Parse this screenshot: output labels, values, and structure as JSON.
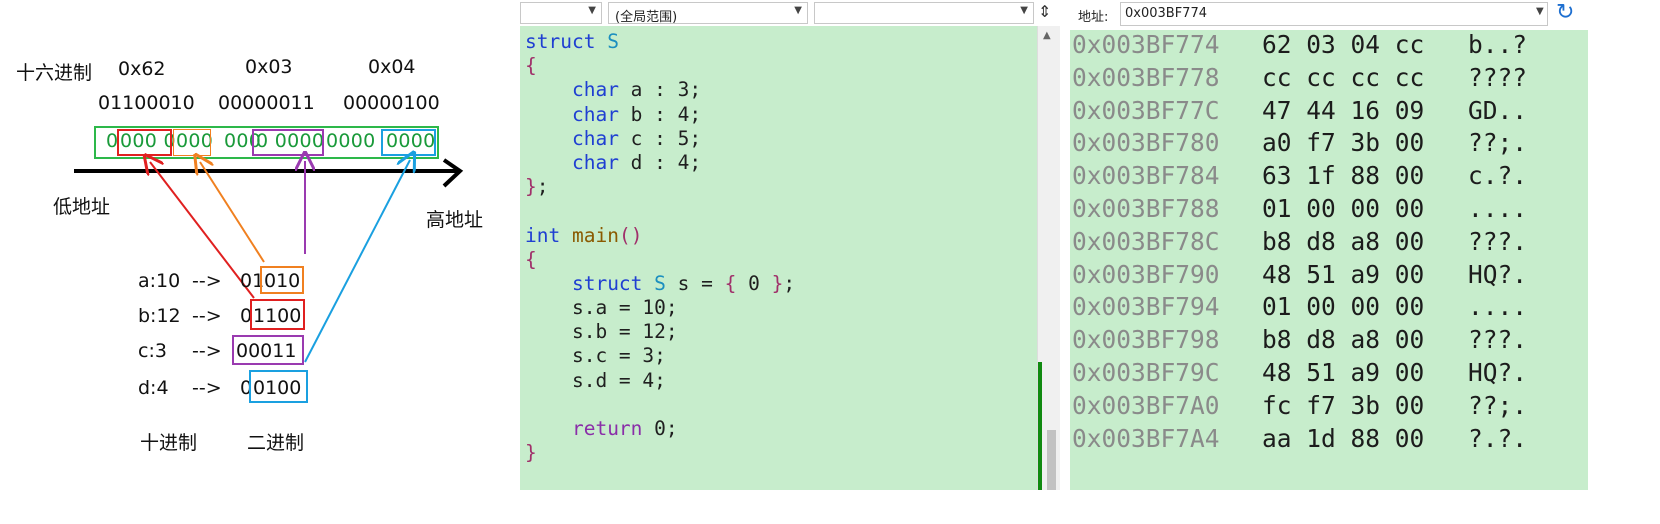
{
  "diagram": {
    "hex_label": "十六进制",
    "hex_values": [
      "0x62",
      "0x03",
      "0x04"
    ],
    "binary_bytes": [
      "01100010",
      "00000011",
      "00000100"
    ],
    "bit_segments": [
      "0",
      "000 0",
      "000 ",
      "000",
      "0 0000",
      " 0000 ",
      "0000"
    ],
    "low_addr_label": "低地址",
    "high_addr_label": "高地址",
    "fields": [
      {
        "name": "a:10",
        "arrow": "-->",
        "bin_prefix": "01",
        "bin_boxed": "010",
        "color": "#f08020"
      },
      {
        "name": "b:12",
        "arrow": "-->",
        "bin_prefix": "0",
        "bin_boxed": "1100",
        "color": "#e02020"
      },
      {
        "name": "c:3",
        "arrow": "-->",
        "bin_prefix": "",
        "bin_boxed": "00011",
        "color": "#9a3ab0"
      },
      {
        "name": "d:4",
        "arrow": "-->",
        "bin_prefix": "0",
        "bin_boxed": "0100",
        "color": "#1aa0e0"
      }
    ],
    "decimal_label": "十进制",
    "binary_label": "二进制"
  },
  "editor": {
    "dropdowns": [
      "",
      "(全局范围)",
      ""
    ],
    "code_lines": [
      [
        [
          "kw",
          "struct"
        ],
        [
          "",
          " "
        ],
        [
          "ty",
          "S"
        ]
      ],
      [
        [
          "br",
          "{"
        ]
      ],
      [
        [
          "",
          "    "
        ],
        [
          "kw",
          "char"
        ],
        [
          "",
          " a : 3;"
        ]
      ],
      [
        [
          "",
          "    "
        ],
        [
          "kw",
          "char"
        ],
        [
          "",
          " b : 4;"
        ]
      ],
      [
        [
          "",
          "    "
        ],
        [
          "kw",
          "char"
        ],
        [
          "",
          " c : 5;"
        ]
      ],
      [
        [
          "",
          "    "
        ],
        [
          "kw",
          "char"
        ],
        [
          "",
          " d : 4;"
        ]
      ],
      [
        [
          "br",
          "}"
        ],
        [
          "",
          ";"
        ]
      ],
      [
        [
          "",
          ""
        ]
      ],
      [
        [
          "kw",
          "int"
        ],
        [
          "",
          " "
        ],
        [
          "fn",
          "main"
        ],
        [
          "br",
          "()"
        ]
      ],
      [
        [
          "br",
          "{"
        ]
      ],
      [
        [
          "",
          "    "
        ],
        [
          "kw",
          "struct"
        ],
        [
          "",
          " "
        ],
        [
          "ty",
          "S"
        ],
        [
          "",
          " s = "
        ],
        [
          "br",
          "{"
        ],
        [
          "",
          " 0 "
        ],
        [
          "br",
          "}"
        ],
        [
          "",
          ";"
        ]
      ],
      [
        [
          "",
          "    s.a = 10;"
        ]
      ],
      [
        [
          "",
          "    s.b = 12;"
        ]
      ],
      [
        [
          "",
          "    s.c = 3;"
        ]
      ],
      [
        [
          "",
          "    s.d = 4;"
        ]
      ],
      [
        [
          "",
          ""
        ]
      ],
      [
        [
          "",
          "    "
        ],
        [
          "kw2",
          "return"
        ],
        [
          "",
          " 0;"
        ]
      ],
      [
        [
          "br",
          "}"
        ]
      ]
    ]
  },
  "memory": {
    "address_label": "地址:",
    "address_value": "0x003BF774",
    "rows": [
      {
        "addr": "0x003BF774",
        "bytes": "62 03 04 cc",
        "ascii": "b..?"
      },
      {
        "addr": "0x003BF778",
        "bytes": "cc cc cc cc",
        "ascii": "????"
      },
      {
        "addr": "0x003BF77C",
        "bytes": "47 44 16 09",
        "ascii": "GD.."
      },
      {
        "addr": "0x003BF780",
        "bytes": "a0 f7 3b 00",
        "ascii": "??;."
      },
      {
        "addr": "0x003BF784",
        "bytes": "63 1f 88 00",
        "ascii": "c.?."
      },
      {
        "addr": "0x003BF788",
        "bytes": "01 00 00 00",
        "ascii": "...."
      },
      {
        "addr": "0x003BF78C",
        "bytes": "b8 d8 a8 00",
        "ascii": "???."
      },
      {
        "addr": "0x003BF790",
        "bytes": "48 51 a9 00",
        "ascii": "HQ?."
      },
      {
        "addr": "0x003BF794",
        "bytes": "01 00 00 00",
        "ascii": "...."
      },
      {
        "addr": "0x003BF798",
        "bytes": "b8 d8 a8 00",
        "ascii": "???."
      },
      {
        "addr": "0x003BF79C",
        "bytes": "48 51 a9 00",
        "ascii": "HQ?."
      },
      {
        "addr": "0x003BF7A0",
        "bytes": "fc f7 3b 00",
        "ascii": "??;."
      },
      {
        "addr": "0x003BF7A4",
        "bytes": "aa 1d 88 00",
        "ascii": "?.?."
      }
    ]
  }
}
